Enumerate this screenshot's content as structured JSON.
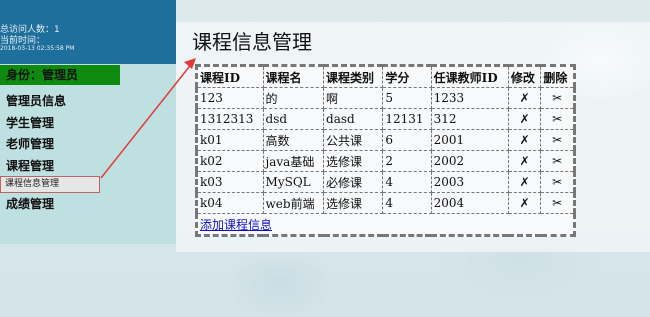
{
  "header": {
    "visitors": "总访问人数：1",
    "current_time_label": "当前时间：",
    "current_time": "2018-03-13 02:35:58 PM"
  },
  "sidebar": {
    "role": "身份：管理员",
    "items": [
      {
        "label": "管理员信息"
      },
      {
        "label": "学生管理"
      },
      {
        "label": "老师管理"
      },
      {
        "label": "课程管理"
      },
      {
        "label": "成绩管理"
      }
    ],
    "submenu_item": "课程信息管理"
  },
  "main": {
    "title": "课程信息管理",
    "columns": [
      "课程ID",
      "课程名",
      "课程类别",
      "学分",
      "任课教师ID",
      "修改",
      "删除"
    ],
    "rows": [
      {
        "id": "123",
        "name": "的",
        "type": "啊",
        "credit": "5",
        "teacher": "1233"
      },
      {
        "id": "1312313",
        "name": "dsd",
        "type": "dasd",
        "credit": "12131",
        "teacher": "312"
      },
      {
        "id": "k01",
        "name": "高数",
        "type": "公共课",
        "credit": "6",
        "teacher": "2001"
      },
      {
        "id": "k02",
        "name": "java基础",
        "type": "选修课",
        "credit": "2",
        "teacher": "2002"
      },
      {
        "id": "k03",
        "name": "MySQL",
        "type": "必修课",
        "credit": "4",
        "teacher": "2003"
      },
      {
        "id": "k04",
        "name": "web前端",
        "type": "选修课",
        "credit": "4",
        "teacher": "2004"
      }
    ],
    "edit_glyph": "✗",
    "delete_glyph": "✂",
    "add_link": "添加课程信息"
  },
  "colors": {
    "header_blue": "#1f6f9c",
    "role_green": "#0e8a0e",
    "sidebar_bg": "#bfe0e0",
    "link_blue": "#1010c0",
    "arrow_red": "#e23a3a"
  }
}
